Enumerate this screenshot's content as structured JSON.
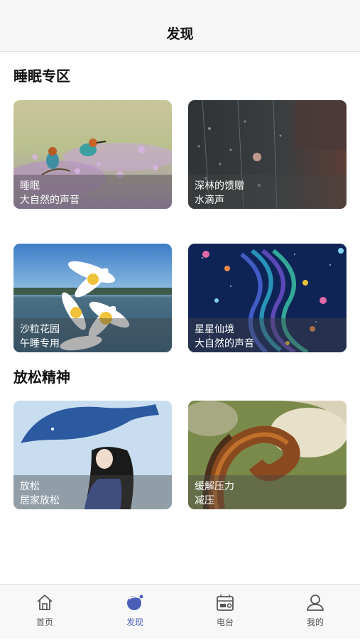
{
  "header": {
    "title": "发现"
  },
  "sections": [
    {
      "title": "睡眠专区"
    },
    {
      "title": "放松精神"
    }
  ],
  "cards": [
    {
      "title": "睡眠",
      "subtitle": "大自然的声音"
    },
    {
      "title": "深林的馈赠",
      "subtitle": "水滴声"
    },
    {
      "title": "沙粒花园",
      "subtitle": "午睡专用"
    },
    {
      "title": "星星仙境",
      "subtitle": "大自然的声音"
    },
    {
      "title": "放松",
      "subtitle": "居家放松"
    },
    {
      "title": "缓解压力",
      "subtitle": "减压"
    }
  ],
  "tabs": [
    {
      "label": "首页",
      "icon": "home-icon",
      "active": false
    },
    {
      "label": "发现",
      "icon": "discover-icon",
      "active": true
    },
    {
      "label": "电台",
      "icon": "radio-icon",
      "active": false
    },
    {
      "label": "我的",
      "icon": "user-icon",
      "active": false
    }
  ],
  "colors": {
    "accent": "#4b5fb8",
    "tab_inactive": "#555555"
  }
}
